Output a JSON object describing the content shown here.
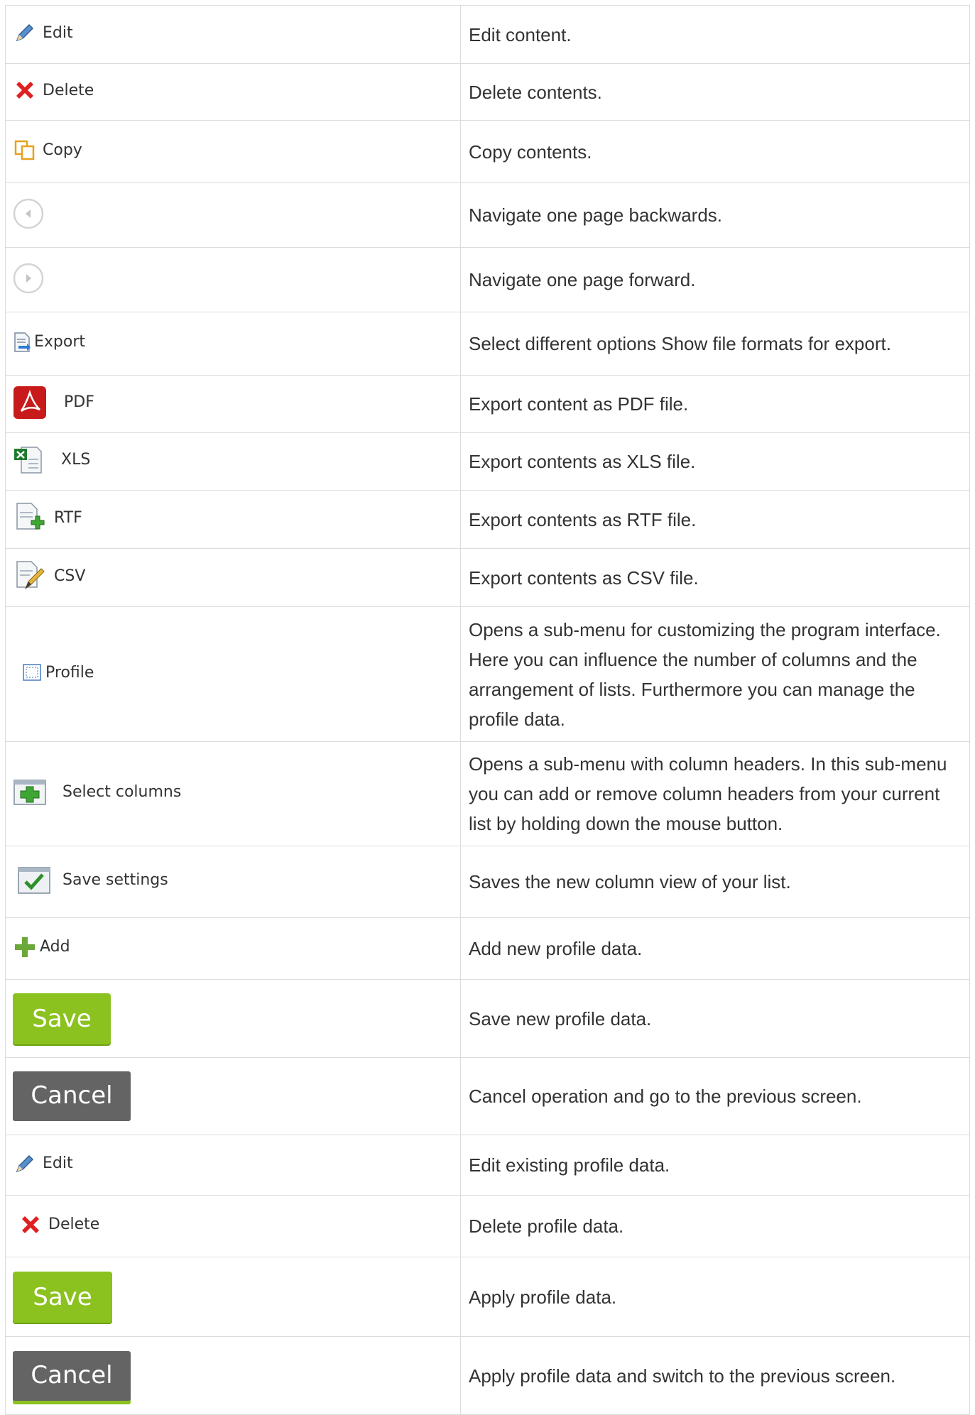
{
  "rows": [
    {
      "label": "Edit",
      "desc": "Edit content."
    },
    {
      "label": "Delete",
      "desc": "Delete contents."
    },
    {
      "label": "Copy",
      "desc": "Copy contents."
    },
    {
      "label": "",
      "desc": "Navigate one page backwards."
    },
    {
      "label": "",
      "desc": "Navigate one page forward."
    },
    {
      "label": "Export",
      "desc": "Select different options Show file formats for export."
    },
    {
      "label": "PDF",
      "desc": "Export content as PDF file."
    },
    {
      "label": "XLS",
      "desc": "Export contents as XLS file."
    },
    {
      "label": "RTF",
      "desc": "Export contents as RTF file."
    },
    {
      "label": "CSV",
      "desc": "Export contents as CSV file."
    },
    {
      "label": "Profile",
      "desc": "Opens a sub-menu for customizing the program interface. Here you can influence the number of columns and the arrangement of lists. Furthermore you can manage the profile data."
    },
    {
      "label": "Select columns",
      "desc": "Opens a sub-menu with column headers. In this sub-menu you can add or remove column headers from your current list by holding down the mouse button."
    },
    {
      "label": "Save settings",
      "desc": "Saves the new column view of your list."
    },
    {
      "label": "Add",
      "desc": "Add new profile data."
    },
    {
      "label": "Save",
      "desc": "Save new profile data."
    },
    {
      "label": "Cancel",
      "desc": "Cancel operation and go to the previous screen."
    },
    {
      "label": "Edit",
      "desc": "Edit existing profile data."
    },
    {
      "label": "Delete",
      "desc": "Delete profile data."
    },
    {
      "label": "Save",
      "desc": "Apply profile data."
    },
    {
      "label": "Cancel",
      "desc": "Apply profile data and switch to the previous screen."
    }
  ],
  "icons": [
    "pencil-icon",
    "x-icon",
    "copy-icon",
    "circle-left-icon",
    "circle-right-icon",
    "export-icon",
    "pdf-icon",
    "xls-icon",
    "rtf-icon",
    "csv-icon",
    "profile-icon",
    "select-columns-icon",
    "save-settings-icon",
    "plus-icon"
  ],
  "colors": {
    "save_button": "#8bc21f",
    "cancel_button": "#646464",
    "border": "#dcdcdc",
    "text": "#333333"
  }
}
